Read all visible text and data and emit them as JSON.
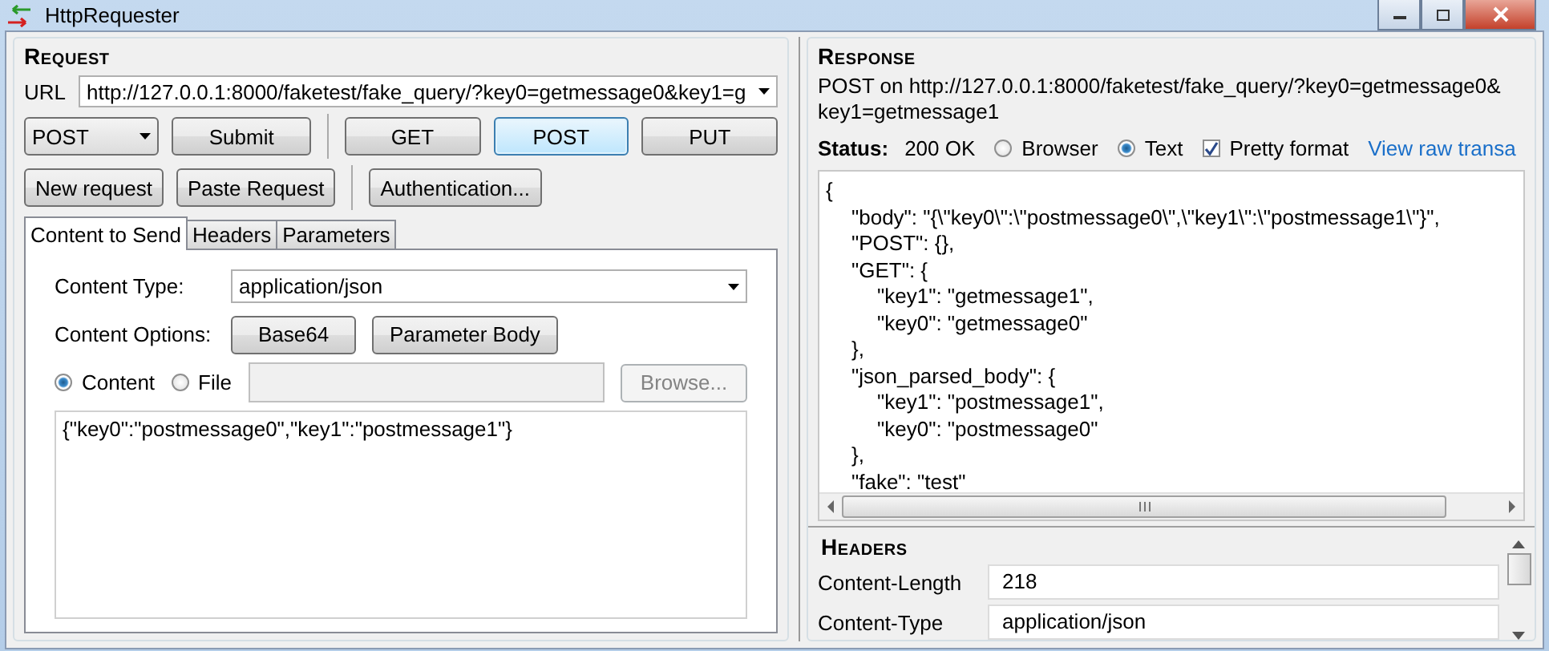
{
  "window": {
    "title": "HttpRequester"
  },
  "request": {
    "heading": "Request",
    "url_label": "URL",
    "url": "http://127.0.0.1:8000/faketest/fake_query/?key0=getmessage0&key1=g",
    "method": "POST",
    "buttons_row1": [
      {
        "label": "Submit",
        "focused": false
      },
      {
        "label": "GET",
        "focused": false
      },
      {
        "label": "POST",
        "focused": true
      },
      {
        "label": "PUT",
        "focused": false
      }
    ],
    "buttons_row2": [
      "New request",
      "Paste Request",
      "Authentication..."
    ],
    "tabs": [
      {
        "label": "Content to Send",
        "selected": true
      },
      {
        "label": "Headers",
        "selected": false
      },
      {
        "label": "Parameters",
        "selected": false
      }
    ],
    "content_type_label": "Content Type:",
    "content_type": "application/json",
    "content_options_label": "Content Options:",
    "content_options": [
      "Base64",
      "Parameter Body"
    ],
    "source_options": [
      {
        "label": "Content",
        "selected": true
      },
      {
        "label": "File",
        "selected": false
      }
    ],
    "browse_button": {
      "label": "Browse...",
      "disabled": true
    },
    "body": "{\"key0\":\"postmessage0\",\"key1\":\"postmessage1\"}"
  },
  "response": {
    "heading": "Response",
    "summary": "POST on http://127.0.0.1:8000/faketest/fake_query/?key0=getmessage0& key1=getmessage1",
    "status_label": "Status:",
    "status": "200 OK",
    "view_options": [
      {
        "label": "Browser",
        "selected": false
      },
      {
        "label": "Text",
        "selected": true
      }
    ],
    "pretty_format": {
      "label": "Pretty format",
      "checked": true
    },
    "raw_link": "View raw transa",
    "body_lines": [
      {
        "text": "{",
        "children": [
          {
            "text": "\"body\": \"{\\\"key0\\\":\\\"postmessage0\\\",\\\"key1\\\":\\\"postmessage1\\\"}\","
          },
          {
            "text": "\"POST\": {},"
          },
          {
            "text": "\"GET\": {",
            "children": [
              {
                "text": "\"key1\": \"getmessage1\","
              },
              {
                "text": "\"key0\": \"getmessage0\""
              }
            ]
          },
          {
            "text": "},"
          },
          {
            "text": "\"json_parsed_body\": {",
            "children": [
              {
                "text": "\"key1\": \"postmessage1\","
              },
              {
                "text": "\"key0\": \"postmessage0\""
              }
            ]
          },
          {
            "text": "},"
          },
          {
            "text": "\"fake\": \"test\""
          }
        ]
      }
    ],
    "headers_heading": "Headers",
    "headers": [
      {
        "name": "Content-Length",
        "value": "218"
      },
      {
        "name": "Content-Type",
        "value": "application/json"
      }
    ]
  }
}
